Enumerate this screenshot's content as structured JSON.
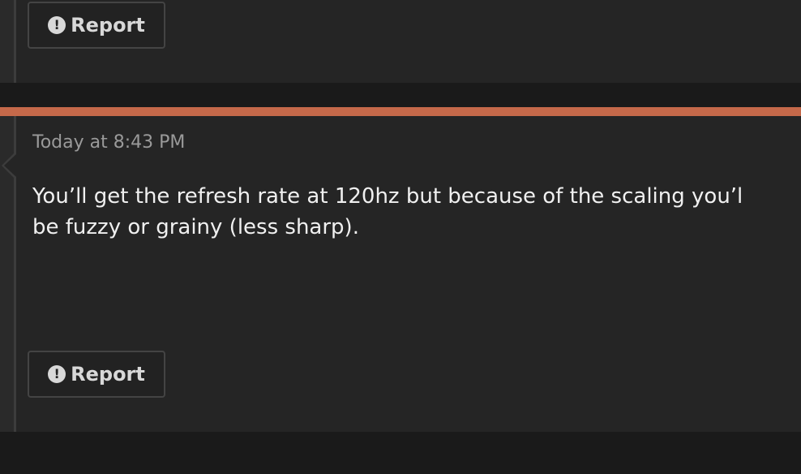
{
  "previous_post": {
    "report_label": "Report",
    "report_icon": "exclamation-circle-icon"
  },
  "post": {
    "timestamp": "Today at 8:43 PM",
    "message_line_1": "You’ll get the refresh rate at 120hz but because of the scaling you’l",
    "message_line_2": "be fuzzy or grainy (less sharp).",
    "report_label": "Report",
    "report_icon": "exclamation-circle-icon"
  },
  "colors": {
    "accent": "#c5694a",
    "background": "#252525",
    "page_background": "#1a1a1a"
  }
}
